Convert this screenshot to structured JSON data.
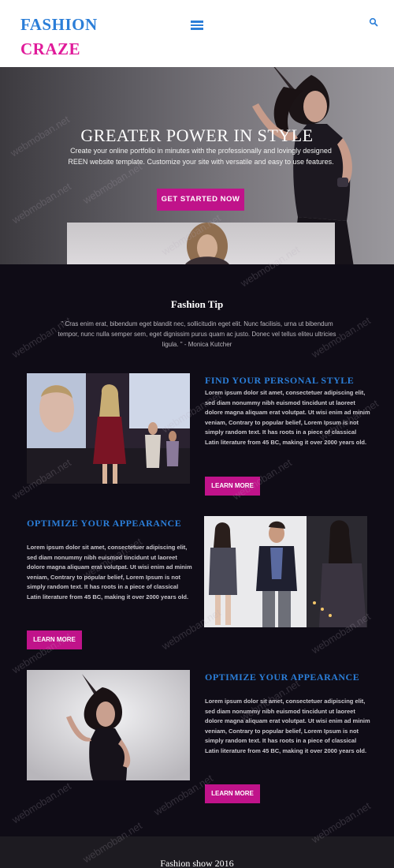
{
  "brand": {
    "line1": "FASHION",
    "line2": "CRAZE",
    "color1": "#2b7ed8",
    "color2": "#e01a9a"
  },
  "header": {
    "menu_icon": "hamburger-menu-icon",
    "search_icon": "search-icon"
  },
  "hero": {
    "title": "GREATER POWER IN STYLE",
    "description": "Create your online portfolio in minutes with the professionally and lovingly designed REEN website template. Customize your site with versatile and easy to use features.",
    "cta_label": "GET STARTED NOW",
    "accent": "#c0138a"
  },
  "tip": {
    "title": "Fashion Tip",
    "text": "\" Cras enim erat, bibendum eget blandit nec, sollicitudin eget elit. Nunc facilisis, urna ut bibendum tempor, nunc nulla semper sem, eget dignissim purus quam ac justo. Donec vel tellus eliteu ultricies ligula. \" - Monica Kutcher"
  },
  "features": [
    {
      "title": "FIND YOUR PERSONAL STYLE",
      "text": "Lorem ipsum dolor sit amet, consectetuer adipiscing elit, sed diam nonummy nibh euismod tincidunt ut laoreet dolore magna aliquam erat volutpat. Ut wisi enim ad minim veniam, Contrary to popular belief, Lorem Ipsum is not simply random text. It has roots in a piece of classical Latin literature from 45 BC, making it over 2000 years old.",
      "button": "LEARN MORE"
    },
    {
      "title": "OPTIMIZE YOUR APPEARANCE",
      "text": "Lorem ipsum dolor sit amet, consectetuer adipiscing elit, sed diam nonummy nibh euismod tincidunt ut laoreet dolore magna aliquam erat volutpat. Ut wisi enim ad minim veniam, Contrary to popular belief, Lorem Ipsum is not simply random text. It has roots in a piece of classical Latin literature from 45 BC, making it over 2000 years old.",
      "button": "LEARN MORE"
    },
    {
      "title": "OPTIMIZE YOUR APPEARANCE",
      "text": "Lorem ipsum dolor sit amet, consectetuer adipiscing elit, sed diam nonummy nibh euismod tincidunt ut laoreet dolore magna aliquam erat volutpat. Ut wisi enim ad minim veniam, Contrary to popular belief, Lorem Ipsum is not simply random text. It has roots in a piece of classical Latin literature from 45 BC, making it over 2000 years old.",
      "button": "LEARN MORE"
    }
  ],
  "footer": {
    "section_title": "Fashion show 2016"
  },
  "watermark": "webmoban.net"
}
